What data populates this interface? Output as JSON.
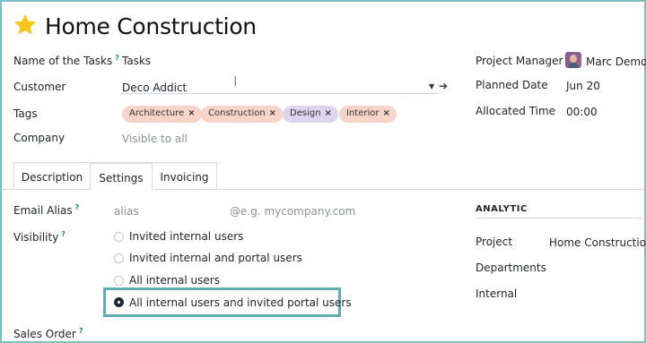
{
  "header": {
    "title": "Home Construction"
  },
  "form": {
    "name_label": "Name of the Tasks",
    "name_help": "?",
    "name_value": "Tasks",
    "customer_label": "Customer",
    "customer_value": "Deco Addict",
    "tags_label": "Tags",
    "tags": [
      {
        "label": "Architecture",
        "remove": "×",
        "color": "#f6d4c8"
      },
      {
        "label": "Construction",
        "remove": "×",
        "color": "#f6d4c8"
      },
      {
        "label": "Design",
        "remove": "×",
        "color": "#ddd4f0"
      },
      {
        "label": "Interior",
        "remove": "×",
        "color": "#f6d4c8"
      }
    ],
    "company_label": "Company",
    "company_placeholder": "Visible to all"
  },
  "side": {
    "manager_label": "Project Manager",
    "manager_value": "Marc Demo",
    "planned_label": "Planned Date",
    "planned_value": "Jun 20",
    "allocated_label": "Allocated Time",
    "allocated_value": "00:00"
  },
  "tabs": [
    {
      "label": "Description"
    },
    {
      "label": "Settings"
    },
    {
      "label": "Invoicing"
    }
  ],
  "settings": {
    "alias_label": "Email Alias",
    "alias_help": "?",
    "alias_placeholder": "alias",
    "domain_placeholder": "@e.g. mycompany.com",
    "visibility_label": "Visibility",
    "visibility_help": "?",
    "options": [
      "Invited internal users",
      "Invited internal and portal users",
      "All internal users",
      "All internal users and invited portal users"
    ],
    "selected_index": 3,
    "sales_order_label": "Sales Order",
    "sales_order_help": "?"
  },
  "analytic": {
    "title": "ANALYTIC",
    "project_label": "Project",
    "project_value": "Home Construction",
    "departments_label": "Departments",
    "internal_label": "Internal"
  },
  "colors": {
    "accent_border": "#5fadb1",
    "star": "#f5c518"
  }
}
